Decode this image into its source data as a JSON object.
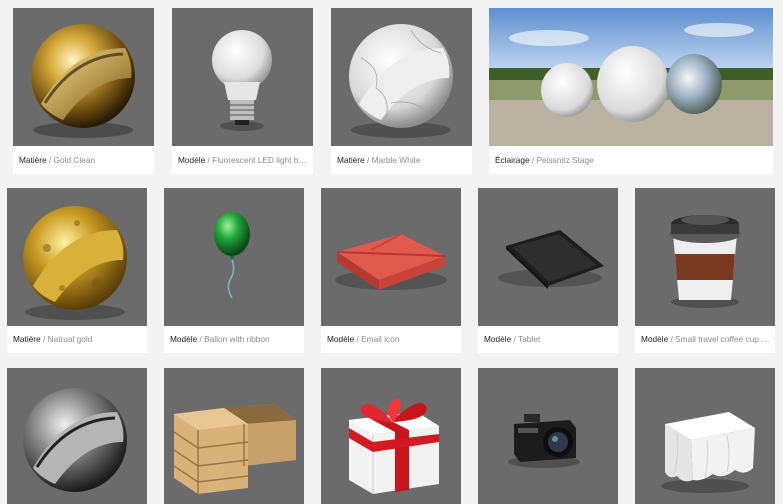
{
  "gallery": {
    "separator": " / ",
    "items": [
      {
        "category": "Matière",
        "name": "Gold Clean",
        "thumb_icon": "gold-sphere-icon"
      },
      {
        "category": "Modèle",
        "name": "Fluorescent LED light bulb",
        "thumb_icon": "light-bulb-icon"
      },
      {
        "category": "Matière",
        "name": "Marble White",
        "thumb_icon": "marble-sphere-icon"
      },
      {
        "category": "Éclairage",
        "name": "Peissnitz Stage",
        "thumb_icon": "environment-spheres-icon"
      },
      {
        "category": "Matière",
        "name": "Natrual gold",
        "thumb_icon": "rough-gold-sphere-icon"
      },
      {
        "category": "Modèle",
        "name": "Ballon with ribbon",
        "thumb_icon": "balloon-icon"
      },
      {
        "category": "Modèle",
        "name": "Email icon",
        "thumb_icon": "envelope-icon"
      },
      {
        "category": "Modèle",
        "name": "Tablet",
        "thumb_icon": "tablet-icon"
      },
      {
        "category": "Modèle",
        "name": "Small travel coffee cup w...",
        "thumb_icon": "coffee-cup-icon"
      },
      {
        "category": "",
        "name": "",
        "thumb_icon": "steel-sphere-icon"
      },
      {
        "category": "",
        "name": "",
        "thumb_icon": "wooden-crates-icon"
      },
      {
        "category": "",
        "name": "",
        "thumb_icon": "gift-box-icon"
      },
      {
        "category": "",
        "name": "",
        "thumb_icon": "camera-icon"
      },
      {
        "category": "",
        "name": "",
        "thumb_icon": "table-cloth-icon"
      }
    ]
  }
}
